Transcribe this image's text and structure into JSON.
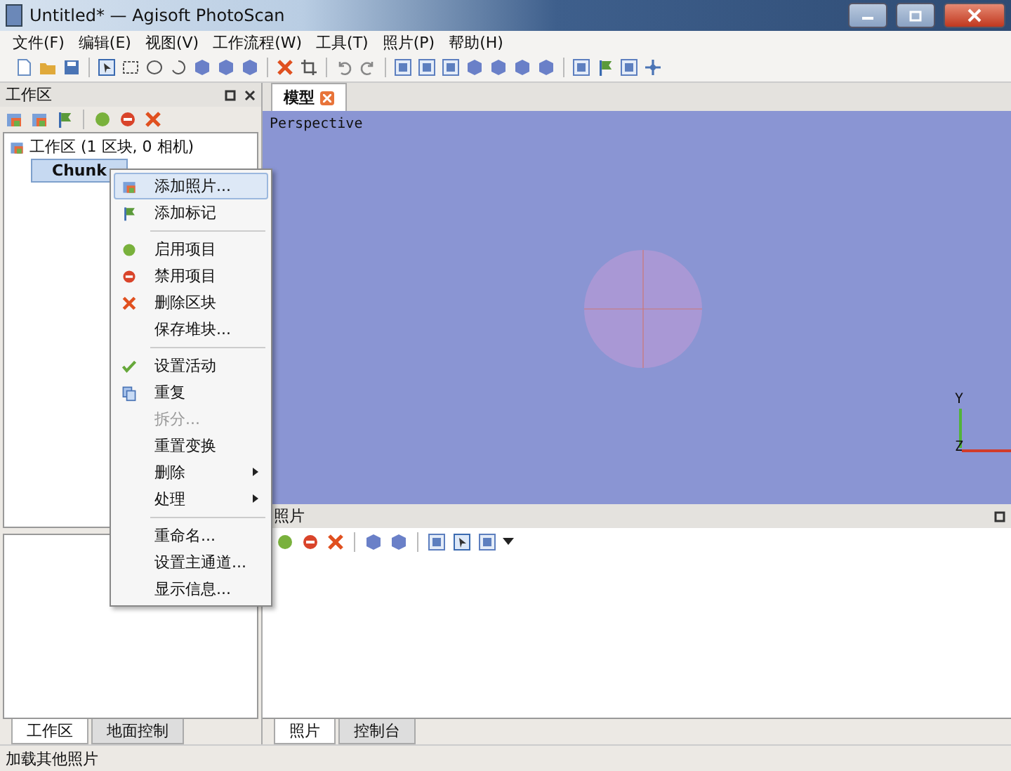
{
  "window": {
    "title": "Untitled* — Agisoft PhotoScan"
  },
  "menu_bar": [
    "文件(F)",
    "编辑(E)",
    "视图(V)",
    "工作流程(W)",
    "工具(T)",
    "照片(P)",
    "帮助(H)"
  ],
  "workspace_panel": {
    "title": "工作区",
    "tree": [
      {
        "label": "工作区 (1 区块, 0 相机)",
        "children": [
          {
            "label": "Chunk",
            "selected": true
          }
        ]
      }
    ]
  },
  "context_menu": [
    {
      "kind": "item",
      "label": "添加照片...",
      "selected": true,
      "disabled": false,
      "submenu": false
    },
    {
      "kind": "item",
      "label": "添加标记",
      "selected": false,
      "disabled": false,
      "submenu": false
    },
    {
      "kind": "separator"
    },
    {
      "kind": "item",
      "label": "启用项目",
      "selected": false,
      "disabled": false,
      "submenu": false
    },
    {
      "kind": "item",
      "label": "禁用项目",
      "selected": false,
      "disabled": false,
      "submenu": false
    },
    {
      "kind": "item",
      "label": "删除区块",
      "selected": false,
      "disabled": false,
      "submenu": false
    },
    {
      "kind": "item",
      "label": "保存堆块...",
      "selected": false,
      "disabled": false,
      "submenu": false
    },
    {
      "kind": "separator"
    },
    {
      "kind": "item",
      "label": "设置活动",
      "selected": false,
      "disabled": false,
      "submenu": false
    },
    {
      "kind": "item",
      "label": "重复",
      "selected": false,
      "disabled": false,
      "submenu": false
    },
    {
      "kind": "item",
      "label": "拆分...",
      "selected": false,
      "disabled": true,
      "submenu": false
    },
    {
      "kind": "item",
      "label": "重置变换",
      "selected": false,
      "disabled": false,
      "submenu": false
    },
    {
      "kind": "item",
      "label": "删除",
      "selected": false,
      "disabled": false,
      "submenu": true
    },
    {
      "kind": "item",
      "label": "处理",
      "selected": false,
      "disabled": false,
      "submenu": true
    },
    {
      "kind": "separator"
    },
    {
      "kind": "item",
      "label": "重命名...",
      "selected": false,
      "disabled": false,
      "submenu": false
    },
    {
      "kind": "item",
      "label": "设置主通道...",
      "selected": false,
      "disabled": false,
      "submenu": false
    },
    {
      "kind": "item",
      "label": "显示信息...",
      "selected": false,
      "disabled": false,
      "submenu": false
    }
  ],
  "left_tabs": [
    {
      "label": "工作区",
      "selected": true
    },
    {
      "label": "地面控制",
      "selected": false
    }
  ],
  "model_view": {
    "tab": "模型",
    "projection": "Perspective",
    "axis_y": "Y",
    "axis_z": "Z"
  },
  "photos_panel": {
    "title": "照片"
  },
  "bottom_tabs": [
    {
      "label": "照片",
      "selected": true
    },
    {
      "label": "控制台",
      "selected": false
    }
  ],
  "status_bar": "加载其他照片"
}
